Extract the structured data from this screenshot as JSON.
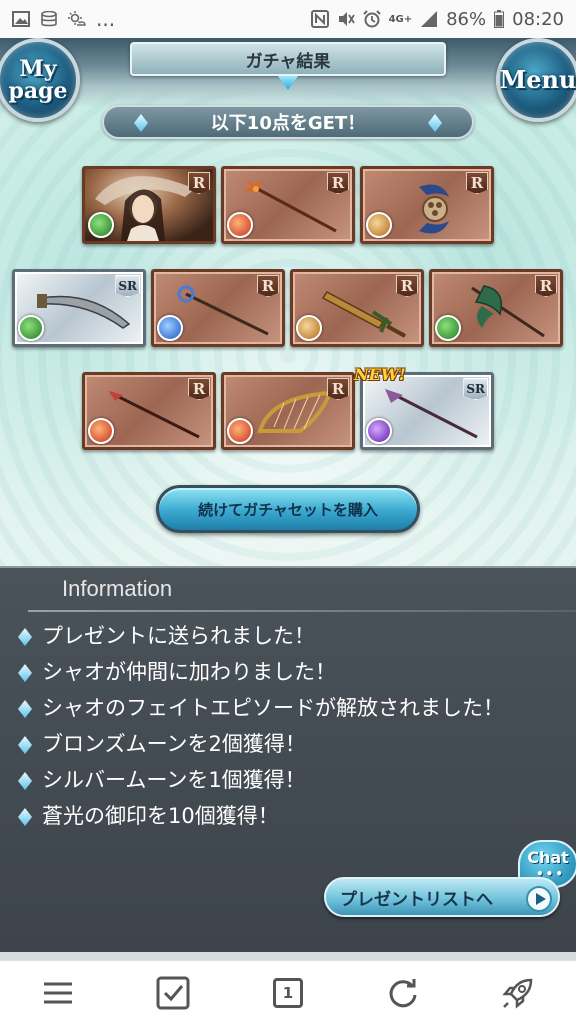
{
  "status_bar": {
    "network_label": "4G+",
    "battery_percent": "86%",
    "time": "08:20",
    "more": "..."
  },
  "header": {
    "title": "ガチャ結果",
    "mypage_line1": "My",
    "mypage_line2": "page",
    "menu_label": "Menu"
  },
  "results": {
    "banner": "以下10点をGET！",
    "new_label": "NEW!",
    "cards": [
      {
        "rarity": "R",
        "element": "wind",
        "kind": "character"
      },
      {
        "rarity": "R",
        "element": "fire",
        "kind": "staff"
      },
      {
        "rarity": "R",
        "element": "earth",
        "kind": "axe"
      },
      {
        "rarity": "SR",
        "element": "wind",
        "kind": "sword"
      },
      {
        "rarity": "R",
        "element": "water",
        "kind": "staff"
      },
      {
        "rarity": "R",
        "element": "earth",
        "kind": "dagger"
      },
      {
        "rarity": "R",
        "element": "wind",
        "kind": "axe"
      },
      {
        "rarity": "R",
        "element": "fire",
        "kind": "spear"
      },
      {
        "rarity": "R",
        "element": "fire",
        "kind": "harp"
      },
      {
        "rarity": "SR",
        "element": "dark",
        "kind": "spear"
      }
    ],
    "buy_button": "続けてガチャセットを購入"
  },
  "information": {
    "title": "Information",
    "items": [
      "プレゼントに送られました！",
      "シャオが仲間に加わりました！",
      "シャオのフェイトエピソードが解放されました！",
      "ブロンズムーンを2個獲得！",
      "シルバームーンを1個獲得！",
      "蒼光の御印を10個獲得！"
    ],
    "present_button": "プレゼントリストへ",
    "chat_label": "Chat",
    "chat_dots": "•••"
  },
  "bottom_nav": {
    "tab_count": "1",
    "icons": [
      "menu-icon",
      "checkbox-icon",
      "tabs-icon",
      "refresh-icon",
      "rocket-icon"
    ]
  }
}
